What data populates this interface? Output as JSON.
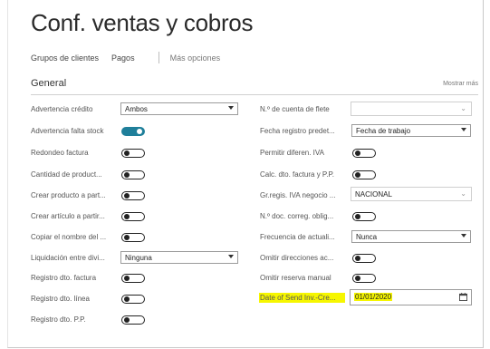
{
  "title": "Conf. ventas y cobros",
  "tabs": [
    "Grupos de clientes",
    "Pagos",
    "Más opciones"
  ],
  "section": {
    "title": "General",
    "show_more": "Mostrar más"
  },
  "left": [
    {
      "label": "Advertencia crédito",
      "type": "select",
      "value": "Ambos"
    },
    {
      "label": "Advertencia falta stock",
      "type": "toggle",
      "on": true
    },
    {
      "label": "Redondeo factura",
      "type": "toggle",
      "on": false
    },
    {
      "label": "Cantidad de product...",
      "type": "toggle",
      "on": false
    },
    {
      "label": "Crear producto a part...",
      "type": "toggle",
      "on": false
    },
    {
      "label": "Crear artículo a partir...",
      "type": "toggle",
      "on": false
    },
    {
      "label": "Copiar el nombre del ...",
      "type": "toggle",
      "on": false
    },
    {
      "label": "Liquidación entre divi...",
      "type": "select",
      "value": "Ninguna"
    },
    {
      "label": "Registro dto. factura",
      "type": "toggle",
      "on": false
    },
    {
      "label": "Registro dto. línea",
      "type": "toggle",
      "on": false
    },
    {
      "label": "Registro dto. P.P.",
      "type": "toggle",
      "on": false
    }
  ],
  "right": [
    {
      "label": "N.º de cuenta de flete",
      "type": "combo",
      "value": ""
    },
    {
      "label": "Fecha registro predet...",
      "type": "select",
      "value": "Fecha de trabajo"
    },
    {
      "label": "Permitir diferen. IVA",
      "type": "toggle",
      "on": false
    },
    {
      "label": "Calc. dto. factura y P.P.",
      "type": "toggle",
      "on": false
    },
    {
      "label": "Gr.regis. IVA negocio ...",
      "type": "combo",
      "value": "NACIONAL"
    },
    {
      "label": "N.º doc. correg. oblig...",
      "type": "toggle",
      "on": false
    },
    {
      "label": "Frecuencia de actuali...",
      "type": "select",
      "value": "Nunca"
    },
    {
      "label": "Omitir direcciones ac...",
      "type": "toggle",
      "on": false
    },
    {
      "label": "Omitir reserva manual",
      "type": "toggle",
      "on": false
    },
    {
      "label": "Date of Send Inv.-Cre...",
      "type": "date",
      "value": "01/01/2020"
    }
  ],
  "colors": {
    "accent": "#1f7f9a",
    "highlight": "#f6f600"
  }
}
